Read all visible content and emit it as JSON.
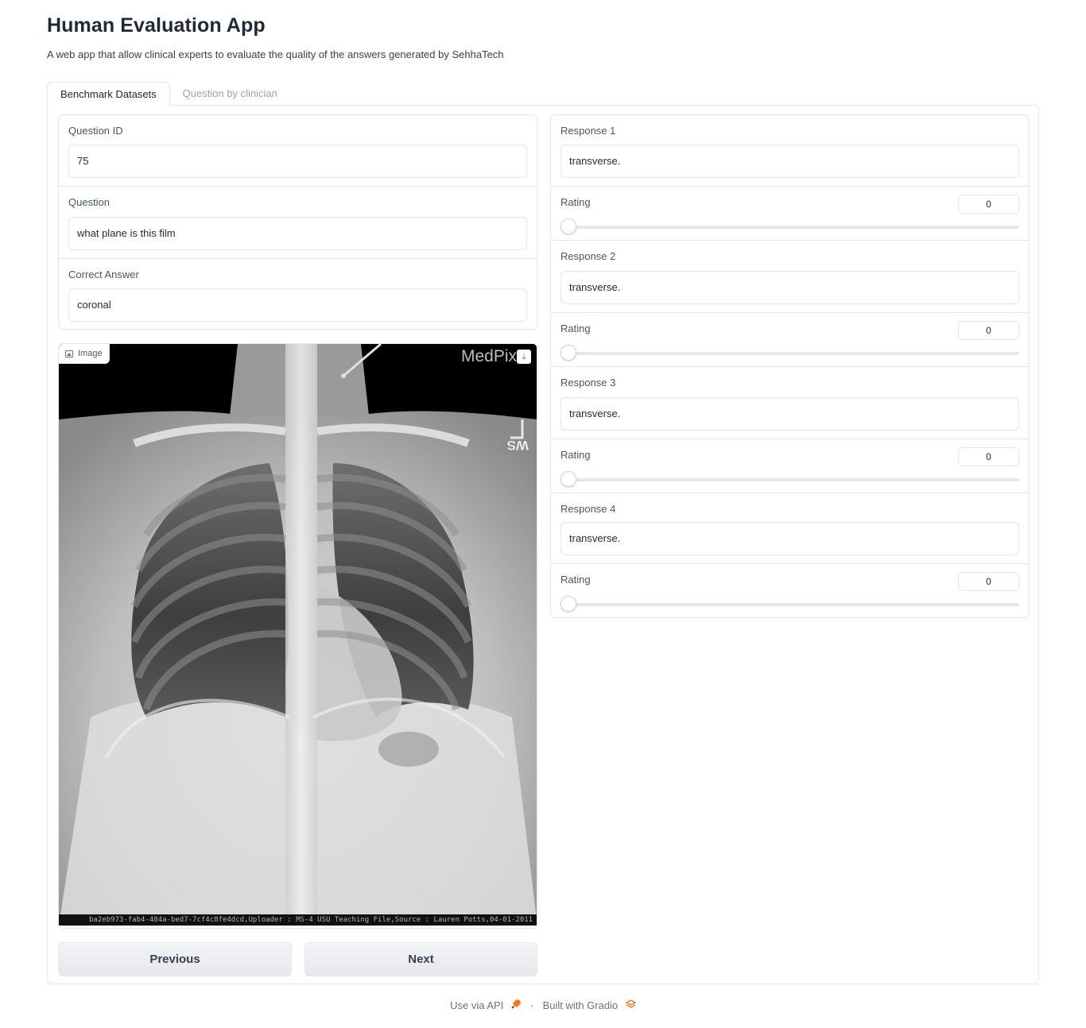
{
  "app": {
    "title": "Human Evaluation App",
    "description": "A web app that allow clinical experts to evaluate the quality of the answers generated by SehhaTech"
  },
  "tabs": [
    {
      "label": "Benchmark Datasets",
      "active": true
    },
    {
      "label": "Question by clinician",
      "active": false
    }
  ],
  "question_fields": {
    "id": {
      "label": "Question ID",
      "value": "75"
    },
    "question": {
      "label": "Question",
      "value": "what plane is this film"
    },
    "answer": {
      "label": "Correct Answer",
      "value": "coronal"
    }
  },
  "image": {
    "label": "Image",
    "watermark": "MedPix",
    "caption": "ba2eb973-fab4-484a-bed7-7cf4c8fe4dcd,Uploader : MS-4  USU Teaching File,Source : Lauren Potts,04-01-2011",
    "marker_text": "WS",
    "subject": "chest-xray"
  },
  "responses": [
    {
      "label": "Response 1",
      "value": "transverse.",
      "rating_label": "Rating",
      "rating": "0"
    },
    {
      "label": "Response 2",
      "value": "transverse.",
      "rating_label": "Rating",
      "rating": "0"
    },
    {
      "label": "Response 3",
      "value": "transverse.",
      "rating_label": "Rating",
      "rating": "0"
    },
    {
      "label": "Response 4",
      "value": "transverse.",
      "rating_label": "Rating",
      "rating": "0"
    }
  ],
  "buttons": {
    "previous": "Previous",
    "next": "Next"
  },
  "footer": {
    "api": "Use via API",
    "separator": "·",
    "built": "Built with Gradio"
  },
  "colors": {
    "border": "#e5e7eb",
    "gradio_orange": "#f97316"
  }
}
